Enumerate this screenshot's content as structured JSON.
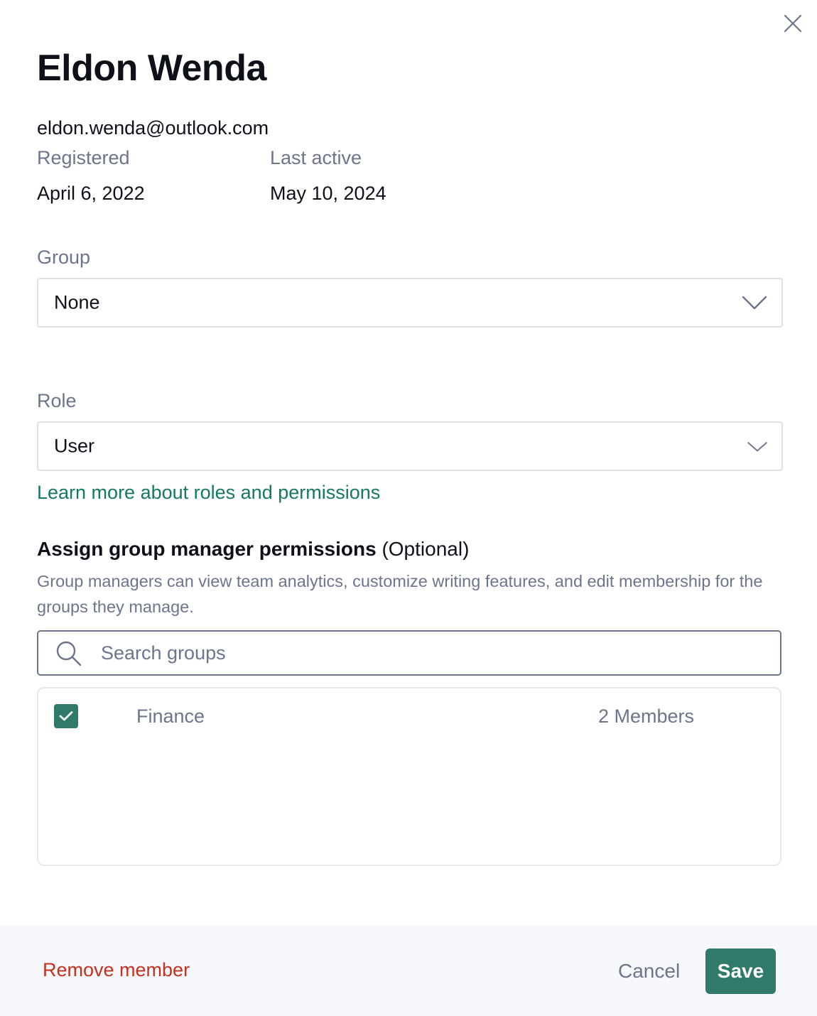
{
  "member": {
    "name": "Eldon Wenda",
    "email": "eldon.wenda@outlook.com",
    "registered_label": "Registered",
    "registered_value": "April 6, 2022",
    "last_active_label": "Last active",
    "last_active_value": "May 10, 2024"
  },
  "group_field": {
    "label": "Group",
    "value": "None"
  },
  "role_field": {
    "label": "Role",
    "value": "User"
  },
  "learn_more_link": "Learn more about roles and permissions",
  "manager_section": {
    "title": "Assign group manager permissions",
    "optional": "(Optional)",
    "description": "Group managers can view team analytics, customize writing features, and edit membership for the groups they manage.",
    "search_placeholder": "Search groups",
    "search_value": "",
    "groups": [
      {
        "name": "Finance",
        "members": "2 Members",
        "checked": true
      }
    ]
  },
  "footer": {
    "remove_label": "Remove member",
    "cancel_label": "Cancel",
    "save_label": "Save"
  },
  "colors": {
    "accent": "#2f7a69",
    "link": "#15795f",
    "danger": "#c6301f",
    "muted_text": "#6d758d",
    "footer_bg": "#f6f7fb"
  },
  "icons": {
    "close": "close-icon",
    "chevron": "chevron-down-icon",
    "search": "search-icon",
    "check": "check-icon"
  }
}
